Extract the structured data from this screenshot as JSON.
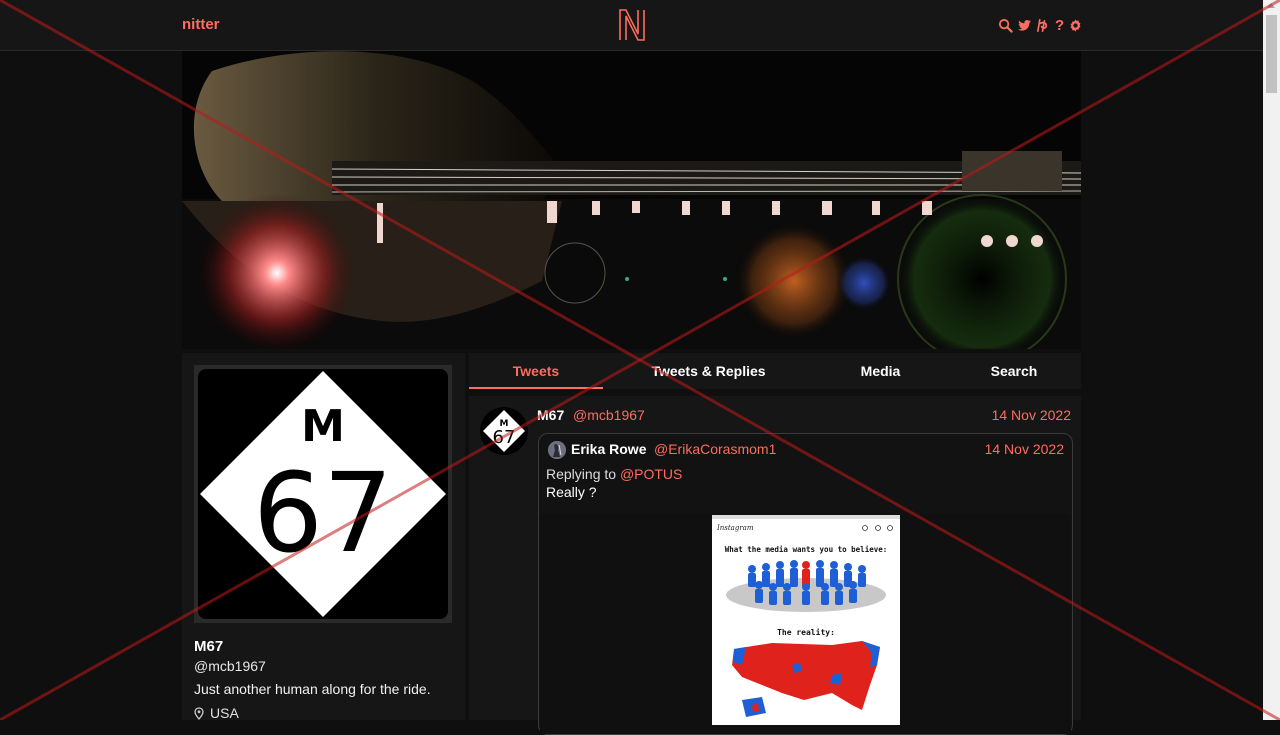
{
  "nav": {
    "brand": "nitter",
    "logo_letter": "N",
    "icons": [
      "search-icon",
      "twitter-icon",
      "rss-icon",
      "help-icon",
      "settings-icon"
    ],
    "help_glyph": "?"
  },
  "profile": {
    "avatar_text": "M",
    "avatar_number": "67",
    "fullname": "M67",
    "username": "@mcb1967",
    "bio": "Just another human along for the ride.",
    "location": "USA"
  },
  "tabs": [
    {
      "label": "Tweets",
      "active": true
    },
    {
      "label": "Tweets & Replies",
      "active": false
    },
    {
      "label": "Media",
      "active": false
    },
    {
      "label": "Search",
      "active": false
    }
  ],
  "tweet": {
    "fullname": "M67",
    "username": "@mcb1967",
    "date": "14 Nov 2022",
    "quote": {
      "fullname": "Erika Rowe",
      "username": "@ErikaCorasmom1",
      "date": "14 Nov 2022",
      "replying_prefix": "Replying to",
      "replying_to": "@POTUS",
      "text": "Really ?",
      "image": {
        "app": "Instagram",
        "caption_top": "What the media wants you to believe:",
        "caption_bottom": "The reality:"
      }
    }
  },
  "colors": {
    "accent": "#ff6c60",
    "background": "#0f0f0f",
    "panel": "#161616"
  }
}
